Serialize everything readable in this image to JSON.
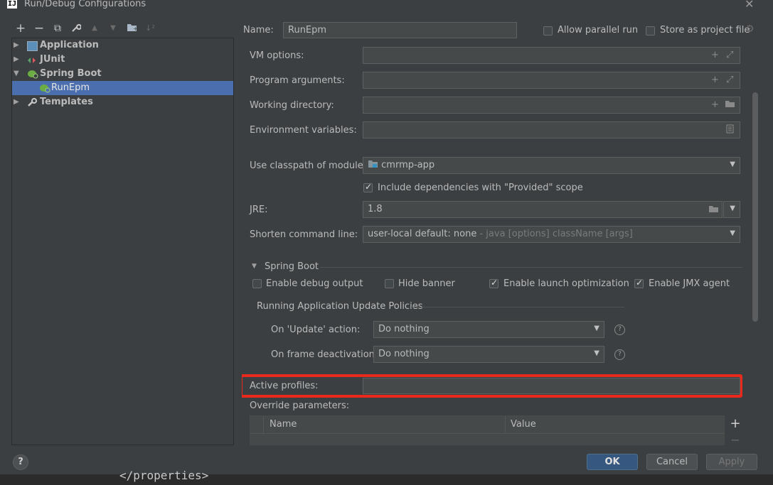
{
  "window": {
    "title": "Run/Debug Configurations"
  },
  "toolbar": {
    "add": "+",
    "remove": "−",
    "copy": "⧉",
    "edit": "🔧",
    "up": "▲",
    "down": "▼",
    "folder": "📁",
    "sort": "↓²"
  },
  "tree": [
    {
      "label": "Application",
      "arrow": "▶",
      "icon": "application-icon"
    },
    {
      "label": "JUnit",
      "arrow": "▶",
      "icon": "junit-icon"
    },
    {
      "label": "Spring Boot",
      "arrow": "▼",
      "icon": "spring-boot-icon"
    },
    {
      "label": "RunEpm",
      "arrow": "",
      "icon": "spring-boot-icon",
      "selected": true
    },
    {
      "label": "Templates",
      "arrow": "▶",
      "icon": "wrench-icon"
    }
  ],
  "header": {
    "name_label": "Name:",
    "name_value": "RunEpm",
    "allow_parallel": "Allow parallel run",
    "store_project": "Store as project file"
  },
  "form": {
    "vm_options": "VM options:",
    "program_args": "Program arguments:",
    "working_dir": "Working directory:",
    "env_vars": "Environment variables:",
    "classpath_label": "Use classpath of module:",
    "classpath_value": "cmrmp-app",
    "include_deps": "Include dependencies with \"Provided\" scope",
    "jre_label": "JRE:",
    "jre_value": "1.8",
    "shorten_label": "Shorten command line:",
    "shorten_value": "user-local default: none",
    "shorten_hint": "- java [options] className [args]"
  },
  "spring": {
    "section": "Spring Boot",
    "debug_output": "Enable debug output",
    "hide_banner": "Hide banner",
    "launch_opt": "Enable launch optimization",
    "jmx": "Enable JMX agent",
    "policies": "Running Application Update Policies",
    "on_update_label": "On 'Update' action:",
    "on_update_value": "Do nothing",
    "on_frame_label": "On frame deactivation:",
    "on_frame_value": "Do nothing",
    "active_profiles": "Active profiles:",
    "override": "Override parameters:",
    "col_name": "Name",
    "col_value": "Value"
  },
  "buttons": {
    "help": "?",
    "ok": "OK",
    "cancel": "Cancel",
    "apply": "Apply"
  },
  "background": {
    "code": "</properties>"
  },
  "colors": {
    "highlight": "#e8291c",
    "selection": "#4b6eaf",
    "primary": "#365880"
  }
}
